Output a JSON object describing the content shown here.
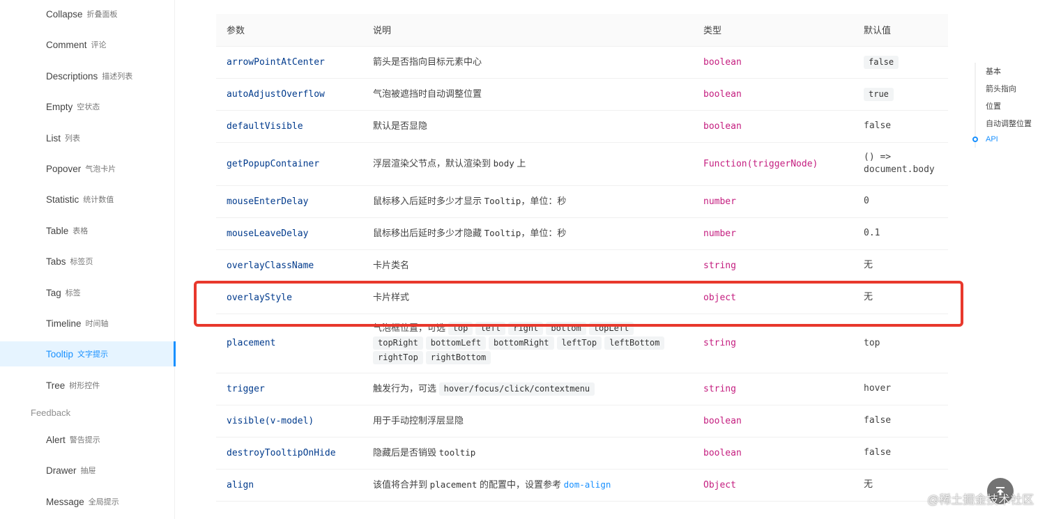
{
  "sidebar": {
    "items": [
      {
        "en": "Collapse",
        "zh": "折叠面板",
        "active": false
      },
      {
        "en": "Comment",
        "zh": "评论",
        "active": false
      },
      {
        "en": "Descriptions",
        "zh": "描述列表",
        "active": false
      },
      {
        "en": "Empty",
        "zh": "空状态",
        "active": false
      },
      {
        "en": "List",
        "zh": "列表",
        "active": false
      },
      {
        "en": "Popover",
        "zh": "气泡卡片",
        "active": false
      },
      {
        "en": "Statistic",
        "zh": "统计数值",
        "active": false
      },
      {
        "en": "Table",
        "zh": "表格",
        "active": false
      },
      {
        "en": "Tabs",
        "zh": "标签页",
        "active": false
      },
      {
        "en": "Tag",
        "zh": "标签",
        "active": false
      },
      {
        "en": "Timeline",
        "zh": "时间轴",
        "active": false
      },
      {
        "en": "Tooltip",
        "zh": "文字提示",
        "active": true
      },
      {
        "en": "Tree",
        "zh": "树形控件",
        "active": false
      }
    ],
    "group_feedback": "Feedback",
    "feedback_items": [
      {
        "en": "Alert",
        "zh": "警告提示"
      },
      {
        "en": "Drawer",
        "zh": "抽屉"
      },
      {
        "en": "Message",
        "zh": "全局提示"
      }
    ]
  },
  "table": {
    "headers": {
      "param": "参数",
      "desc": "说明",
      "type": "类型",
      "default": "默认值"
    },
    "rows": [
      {
        "param": "arrowPointAtCenter",
        "desc": "箭头是否指向目标元素中心",
        "type": "boolean",
        "default": "false"
      },
      {
        "param": "autoAdjustOverflow",
        "desc": "气泡被遮挡时自动调整位置",
        "type": "boolean",
        "default": "true"
      },
      {
        "param": "defaultVisible",
        "desc": "默认是否显隐",
        "type": "boolean",
        "default": "false"
      },
      {
        "param": "getPopupContainer",
        "desc_pre": "浮层渲染父节点，默认渲染到",
        "desc_code": "body",
        "desc_post": "上",
        "type": "Function(triggerNode)",
        "default_l1": "() =>",
        "default_l2": "document.body"
      },
      {
        "param": "mouseEnterDelay",
        "desc_pre": "鼠标移入后延时多少才显示",
        "desc_code": "Tooltip",
        "desc_post": "，单位：秒",
        "type": "number",
        "default": "0"
      },
      {
        "param": "mouseLeaveDelay",
        "desc_pre": "鼠标移出后延时多少才隐藏",
        "desc_code": "Tooltip",
        "desc_post": "，单位：秒",
        "type": "number",
        "default": "0.1"
      },
      {
        "param": "overlayClassName",
        "desc": "卡片类名",
        "type": "string",
        "default": "无"
      },
      {
        "param": "overlayStyle",
        "desc": "卡片样式",
        "type": "object",
        "default": "无"
      },
      {
        "param": "placement",
        "desc_pre": "气泡框位置，可选",
        "codes": [
          "top",
          "left",
          "right",
          "bottom",
          "topLeft",
          "topRight",
          "bottomLeft",
          "bottomRight",
          "leftTop",
          "leftBottom",
          "rightTop",
          "rightBottom"
        ],
        "type": "string",
        "default": "top"
      },
      {
        "param": "trigger",
        "desc_pre": "触发行为，可选",
        "desc_code": "hover/focus/click/contextmenu",
        "type": "string",
        "default": "hover"
      },
      {
        "param": "visible(v-model)",
        "desc": "用于手动控制浮层显隐",
        "type": "boolean",
        "default": "false"
      },
      {
        "param": "destroyTooltipOnHide",
        "desc_pre": "隐藏后是否销毁",
        "desc_code": "tooltip",
        "type": "boolean",
        "default": "false"
      },
      {
        "param": "align",
        "desc_pre": "该值将合并到",
        "desc_code": "placement",
        "desc_mid": "的配置中，设置参考",
        "desc_link": "dom-align",
        "type": "Object",
        "default": "无"
      }
    ]
  },
  "anchor": {
    "items": [
      "基本",
      "箭头指向",
      "位置",
      "自动调整位置",
      "API"
    ],
    "active_index": 4
  },
  "watermark": "@稀土掘金技术社区",
  "colors": {
    "accent": "#1890ff",
    "param": "#003a8c",
    "type": "#c41d7f",
    "highlight": "#e8382c"
  }
}
